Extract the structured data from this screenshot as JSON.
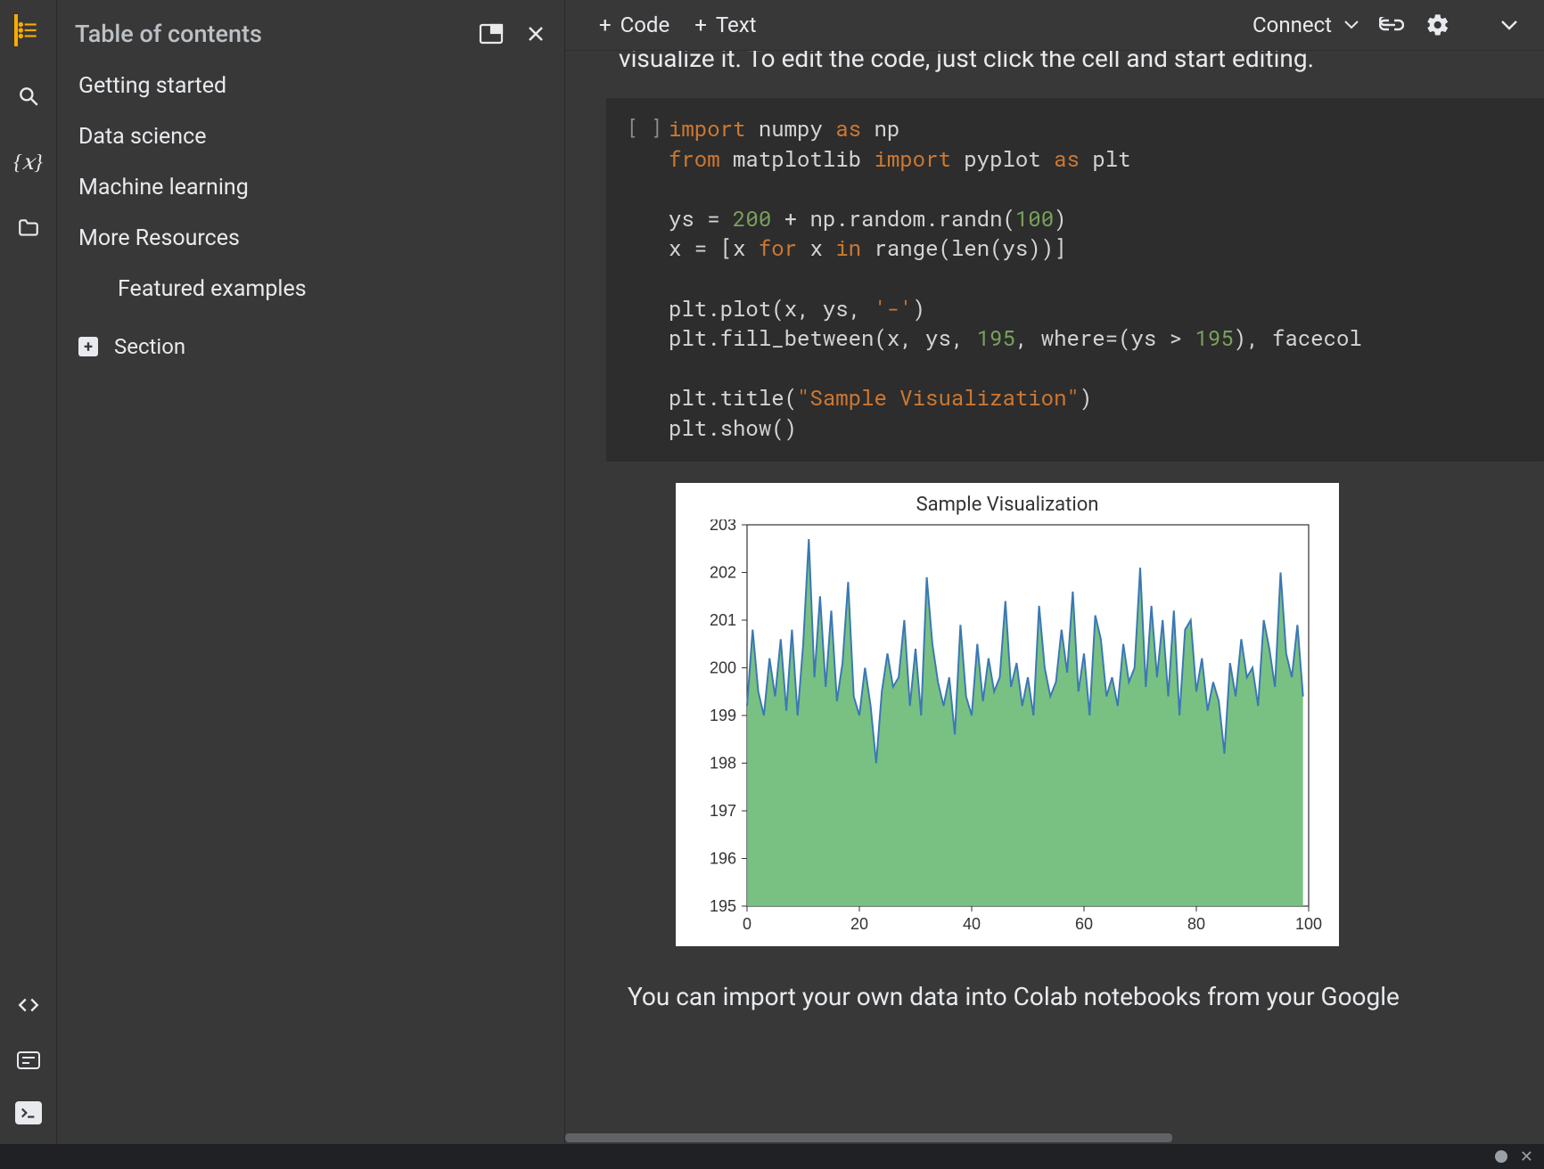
{
  "toc": {
    "title": "Table of contents",
    "items": [
      "Getting started",
      "Data science",
      "Machine learning",
      "More Resources"
    ],
    "sub": [
      "Featured examples"
    ],
    "add_label": "Section"
  },
  "toolbar": {
    "code_label": "Code",
    "text_label": "Text",
    "connect_label": "Connect"
  },
  "intro_partial": "visualize it. To edit the code, just click the cell and start editing.",
  "cell_prefix": "[ ]",
  "code_lines": {
    "l1a": "import",
    "l1b": "numpy",
    "l1c": "as",
    "l1d": "np",
    "l2a": "from",
    "l2b": "matplotlib",
    "l2c": "import",
    "l2d": "pyplot",
    "l2e": "as",
    "l2f": "plt",
    "l3a": "ys = ",
    "l3b": "200",
    "l3c": " + np.random.randn(",
    "l3d": "100",
    "l3e": ")",
    "l4a": "x = [x ",
    "l4b": "for",
    "l4c": " x ",
    "l4d": "in",
    "l4e": " range(len(ys))]",
    "l5a": "plt.plot(x, ys, ",
    "l5b": "'-'",
    "l5c": ")",
    "l6a": "plt.fill_between(x, ys, ",
    "l6b": "195",
    "l6c": ", where=(ys > ",
    "l6d": "195",
    "l6e": "), facecol",
    "l7a": "plt.title(",
    "l7b": "\"Sample Visualization\"",
    "l7c": ")",
    "l8a": "plt.show()"
  },
  "footer_text": "You can import your own data into Colab notebooks from your Google",
  "chart_data": {
    "type": "area",
    "title": "Sample Visualization",
    "xlabel": "",
    "ylabel": "",
    "xlim": [
      0,
      100
    ],
    "ylim": [
      195,
      203
    ],
    "xticks": [
      0,
      20,
      40,
      60,
      80,
      100
    ],
    "yticks": [
      195,
      196,
      197,
      198,
      199,
      200,
      201,
      202,
      203
    ],
    "fill_threshold": 195,
    "x": [
      0,
      1,
      2,
      3,
      4,
      5,
      6,
      7,
      8,
      9,
      10,
      11,
      12,
      13,
      14,
      15,
      16,
      17,
      18,
      19,
      20,
      21,
      22,
      23,
      24,
      25,
      26,
      27,
      28,
      29,
      30,
      31,
      32,
      33,
      34,
      35,
      36,
      37,
      38,
      39,
      40,
      41,
      42,
      43,
      44,
      45,
      46,
      47,
      48,
      49,
      50,
      51,
      52,
      53,
      54,
      55,
      56,
      57,
      58,
      59,
      60,
      61,
      62,
      63,
      64,
      65,
      66,
      67,
      68,
      69,
      70,
      71,
      72,
      73,
      74,
      75,
      76,
      77,
      78,
      79,
      80,
      81,
      82,
      83,
      84,
      85,
      86,
      87,
      88,
      89,
      90,
      91,
      92,
      93,
      94,
      95,
      96,
      97,
      98,
      99
    ],
    "ys": [
      199.2,
      200.8,
      199.5,
      199.0,
      200.2,
      199.4,
      200.6,
      199.1,
      200.8,
      199.0,
      200.5,
      202.7,
      199.8,
      201.5,
      199.6,
      201.2,
      199.3,
      200.1,
      201.8,
      199.4,
      199.0,
      200.0,
      199.2,
      198.0,
      199.5,
      200.3,
      199.6,
      199.8,
      201.0,
      199.2,
      200.4,
      199.0,
      201.9,
      200.5,
      199.7,
      199.2,
      199.8,
      198.6,
      200.9,
      199.4,
      199.0,
      200.5,
      199.3,
      200.2,
      199.5,
      199.8,
      201.4,
      199.6,
      200.1,
      199.2,
      199.8,
      199.0,
      201.3,
      200.0,
      199.4,
      199.7,
      200.8,
      199.9,
      201.6,
      199.5,
      200.3,
      199.0,
      201.1,
      200.6,
      199.4,
      199.8,
      199.2,
      200.5,
      199.7,
      200.0,
      202.1,
      199.6,
      201.3,
      199.8,
      201.0,
      199.4,
      201.2,
      199.0,
      200.8,
      201.0,
      199.5,
      200.2,
      199.1,
      199.7,
      199.3,
      198.2,
      200.1,
      199.4,
      200.6,
      199.8,
      200.0,
      199.2,
      201.0,
      200.4,
      199.6,
      202.0,
      200.3,
      199.8,
      200.9,
      199.4
    ]
  }
}
